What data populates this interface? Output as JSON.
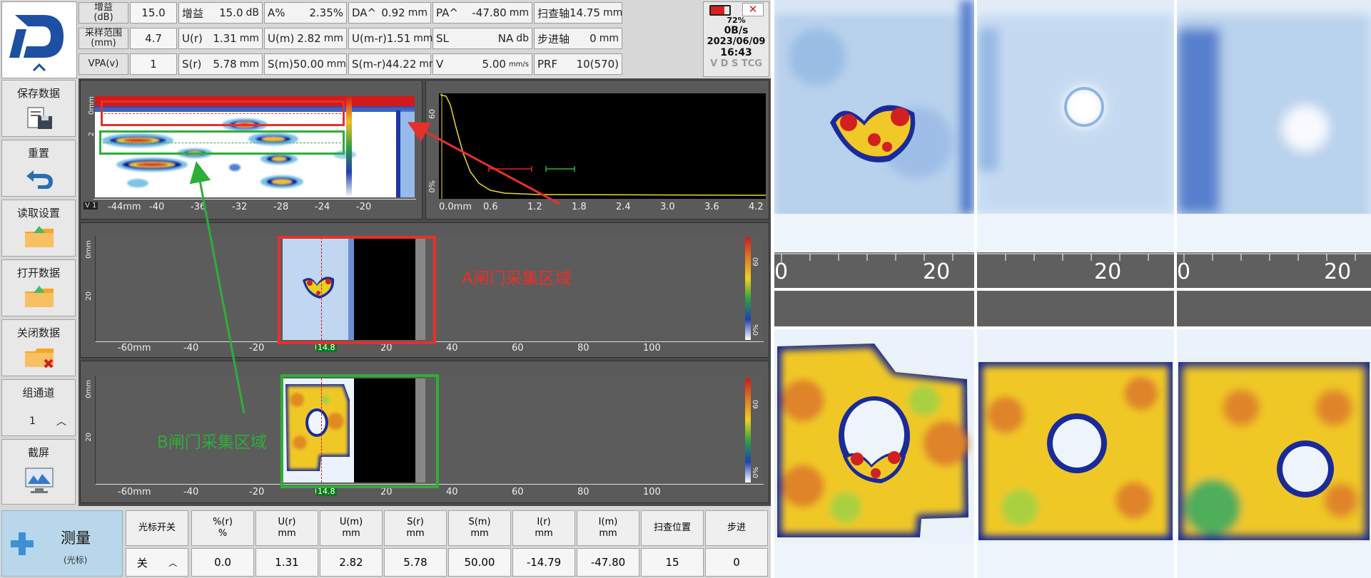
{
  "header": {
    "row1": [
      {
        "label": "增益\n(dB)",
        "value": "15.0"
      },
      {
        "name": "增益",
        "value": "15.0",
        "unit": "dB"
      },
      {
        "name": "A%",
        "value": "2.35%",
        "unit": ""
      },
      {
        "name": "DA^",
        "value": "0.92",
        "unit": "mm"
      },
      {
        "name": "PA^",
        "value": "-47.80",
        "unit": "mm"
      },
      {
        "name": "扫查轴",
        "value": "14.75",
        "unit": "mm"
      }
    ],
    "row2": [
      {
        "label": "采样范围\n(mm)",
        "value": "4.7"
      },
      {
        "name": "U(r)",
        "value": "1.31",
        "unit": "mm"
      },
      {
        "name": "U(m)",
        "value": "2.82",
        "unit": "mm"
      },
      {
        "name": "U(m-r)",
        "value": "1.51",
        "unit": "mm"
      },
      {
        "name": "SL",
        "value": "NA",
        "unit": "db"
      },
      {
        "name": "步进轴",
        "value": "0",
        "unit": "mm"
      }
    ],
    "row3": [
      {
        "label": "VPA(v)",
        "value": "1"
      },
      {
        "name": "S(r)",
        "value": "5.78",
        "unit": "mm"
      },
      {
        "name": "S(m)",
        "value": "50.00",
        "unit": "mm"
      },
      {
        "name": "S(m-r)",
        "value": "44.22",
        "unit": "mm"
      },
      {
        "name": "V",
        "value": "5.00",
        "unit": "mm/s"
      },
      {
        "name": "PRF",
        "value": "10(570)",
        "unit": ""
      }
    ]
  },
  "status": {
    "battery": "72%",
    "rate": "0B/s",
    "date": "2023/06/09",
    "time": "16:43",
    "flags": "V D S TCG",
    "battery_level": 0.72
  },
  "sidebar": {
    "save": "保存数据",
    "reset": "重置",
    "read_settings": "读取设置",
    "open_data": "打开数据",
    "close_data": "关闭数据",
    "group_label": "组通道",
    "group_value": "1",
    "screenshot": "截屏"
  },
  "bscan": {
    "y_unit": "0mm",
    "y_tick": "2",
    "x_ticks": [
      "-44mm",
      "-40",
      "-36",
      "-32",
      "-28",
      "-24",
      "-20"
    ],
    "corner": "V 1"
  },
  "ascan": {
    "x_ticks": [
      "0.0mm",
      "0.6",
      "1.2",
      "1.8",
      "2.4",
      "3.0",
      "3.6",
      "4.2"
    ],
    "y_ticks": [
      "60",
      "0%"
    ]
  },
  "cscan_a": {
    "y_ticks": [
      "0mm",
      "20"
    ],
    "x_ticks": [
      "-60mm",
      "-40",
      "-20",
      "0",
      "20",
      "40",
      "60",
      "80",
      "100"
    ],
    "cursor": "14.8",
    "scale_ticks": [
      "60",
      "0%"
    ],
    "annotation": "A闸门采集区域"
  },
  "cscan_b": {
    "y_ticks": [
      "0mm",
      "20"
    ],
    "x_ticks": [
      "-60mm",
      "-40",
      "-20",
      "0",
      "20",
      "40",
      "60",
      "80",
      "100"
    ],
    "cursor": "14.8",
    "scale_ticks": [
      "60",
      "0%"
    ],
    "annotation": "B闸门采集区域"
  },
  "measure": {
    "title": "测量",
    "subtitle": "(光标)",
    "cursor_switch_label": "光标开关",
    "cursor_switch_value": "关",
    "columns": [
      {
        "h1": "%(r)",
        "h2": "%",
        "v": "0.0"
      },
      {
        "h1": "U(r)",
        "h2": "mm",
        "v": "1.31"
      },
      {
        "h1": "U(m)",
        "h2": "mm",
        "v": "2.82"
      },
      {
        "h1": "S(r)",
        "h2": "mm",
        "v": "5.78"
      },
      {
        "h1": "S(m)",
        "h2": "mm",
        "v": "50.00"
      },
      {
        "h1": "I(r)",
        "h2": "mm",
        "v": "-14.79"
      },
      {
        "h1": "I(m)",
        "h2": "mm",
        "v": "-47.80"
      },
      {
        "h1": "扫查位置",
        "h2": "",
        "v": "15"
      },
      {
        "h1": "步进",
        "h2": "",
        "v": "0"
      }
    ]
  },
  "right_panels": {
    "ruler_labels": [
      "0",
      "20",
      "20",
      "0",
      "20"
    ]
  },
  "colors": {
    "annotation_a": "#e8302a",
    "annotation_b": "#2fae37",
    "label": "#d23a2a"
  }
}
